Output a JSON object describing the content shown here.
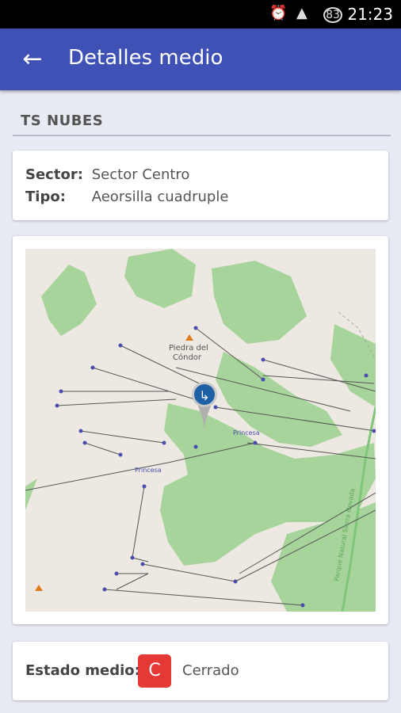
{
  "status": {
    "time": "21:23",
    "icons": [
      "alarm-icon",
      "signal-3g-icon",
      "battery-icon"
    ],
    "battery": "83"
  },
  "appbar": {
    "title": "Detalles medio",
    "back_icon": "arrow-back-icon"
  },
  "section": {
    "title": "TS NUBES"
  },
  "info": {
    "sector_label": "Sector:",
    "sector_value": "Sector Centro",
    "tipo_label": "Tipo:",
    "tipo_value": "Aeorsilla cuadruple"
  },
  "map": {
    "labels": {
      "peak": "Piedra del\nCóndor",
      "princesa1": "Princesa",
      "princesa2": "Princesa",
      "park": "Parque Natural Sierra Nevada"
    },
    "marker_icon": "ski-lift-pin-icon"
  },
  "estado": {
    "label": "Estado medio:",
    "badge": "C",
    "value": "Cerrado",
    "badge_color": "#e53935"
  },
  "colors": {
    "appbar": "#3f51b5",
    "map_green": "#a6d49a",
    "background": "#e8eaf4"
  }
}
